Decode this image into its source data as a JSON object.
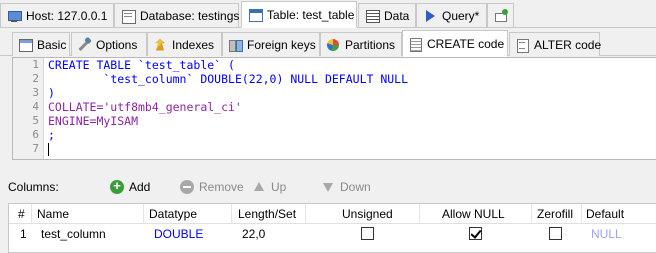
{
  "top_tabs": [
    {
      "label": "Host: 127.0.0.1",
      "icon": "host-icon"
    },
    {
      "label": "Database: testings",
      "icon": "database-icon"
    },
    {
      "label": "Table: test_table",
      "icon": "table-icon",
      "active": true
    },
    {
      "label": "Data",
      "icon": "data-icon"
    },
    {
      "label": "Query*",
      "icon": "query-icon"
    },
    {
      "label": "",
      "icon": "new-query-tab-icon"
    }
  ],
  "sub_tabs": [
    {
      "label": "Basic",
      "icon": "basic-icon"
    },
    {
      "label": "Options",
      "icon": "options-icon"
    },
    {
      "label": "Indexes",
      "icon": "indexes-icon"
    },
    {
      "label": "Foreign keys",
      "icon": "foreign-keys-icon"
    },
    {
      "label": "Partitions",
      "icon": "partitions-icon"
    },
    {
      "label": "CREATE code",
      "icon": "create-code-icon",
      "active": true
    },
    {
      "label": "ALTER code",
      "icon": "alter-code-icon"
    }
  ],
  "editor": {
    "line_numbers": [
      "1",
      "2",
      "3",
      "4",
      "5",
      "6",
      "7"
    ],
    "lines": [
      "CREATE TABLE `test_table` (",
      "\t`test_column` DOUBLE(22,0) NULL DEFAULT NULL",
      ")",
      "COLLATE='utf8mb4_general_ci'",
      "ENGINE=MyISAM",
      ";",
      ""
    ]
  },
  "columns_toolbar": {
    "label": "Columns:",
    "add": "Add",
    "remove": "Remove",
    "up": "Up",
    "down": "Down"
  },
  "grid": {
    "headers": [
      "#",
      "Name",
      "Datatype",
      "Length/Set",
      "Unsigned",
      "Allow NULL",
      "Zerofill",
      "Default"
    ],
    "rows": [
      {
        "num": "1",
        "name": "test_column",
        "datatype": "DOUBLE",
        "length": "22,0",
        "unsigned": false,
        "allow_null": true,
        "zerofill": false,
        "default": "NULL"
      }
    ]
  },
  "colors": {
    "keyword": "#0000ff",
    "string": "#8e24aa",
    "datatype": "#0000ff",
    "null_default": "#a0a0ff"
  }
}
